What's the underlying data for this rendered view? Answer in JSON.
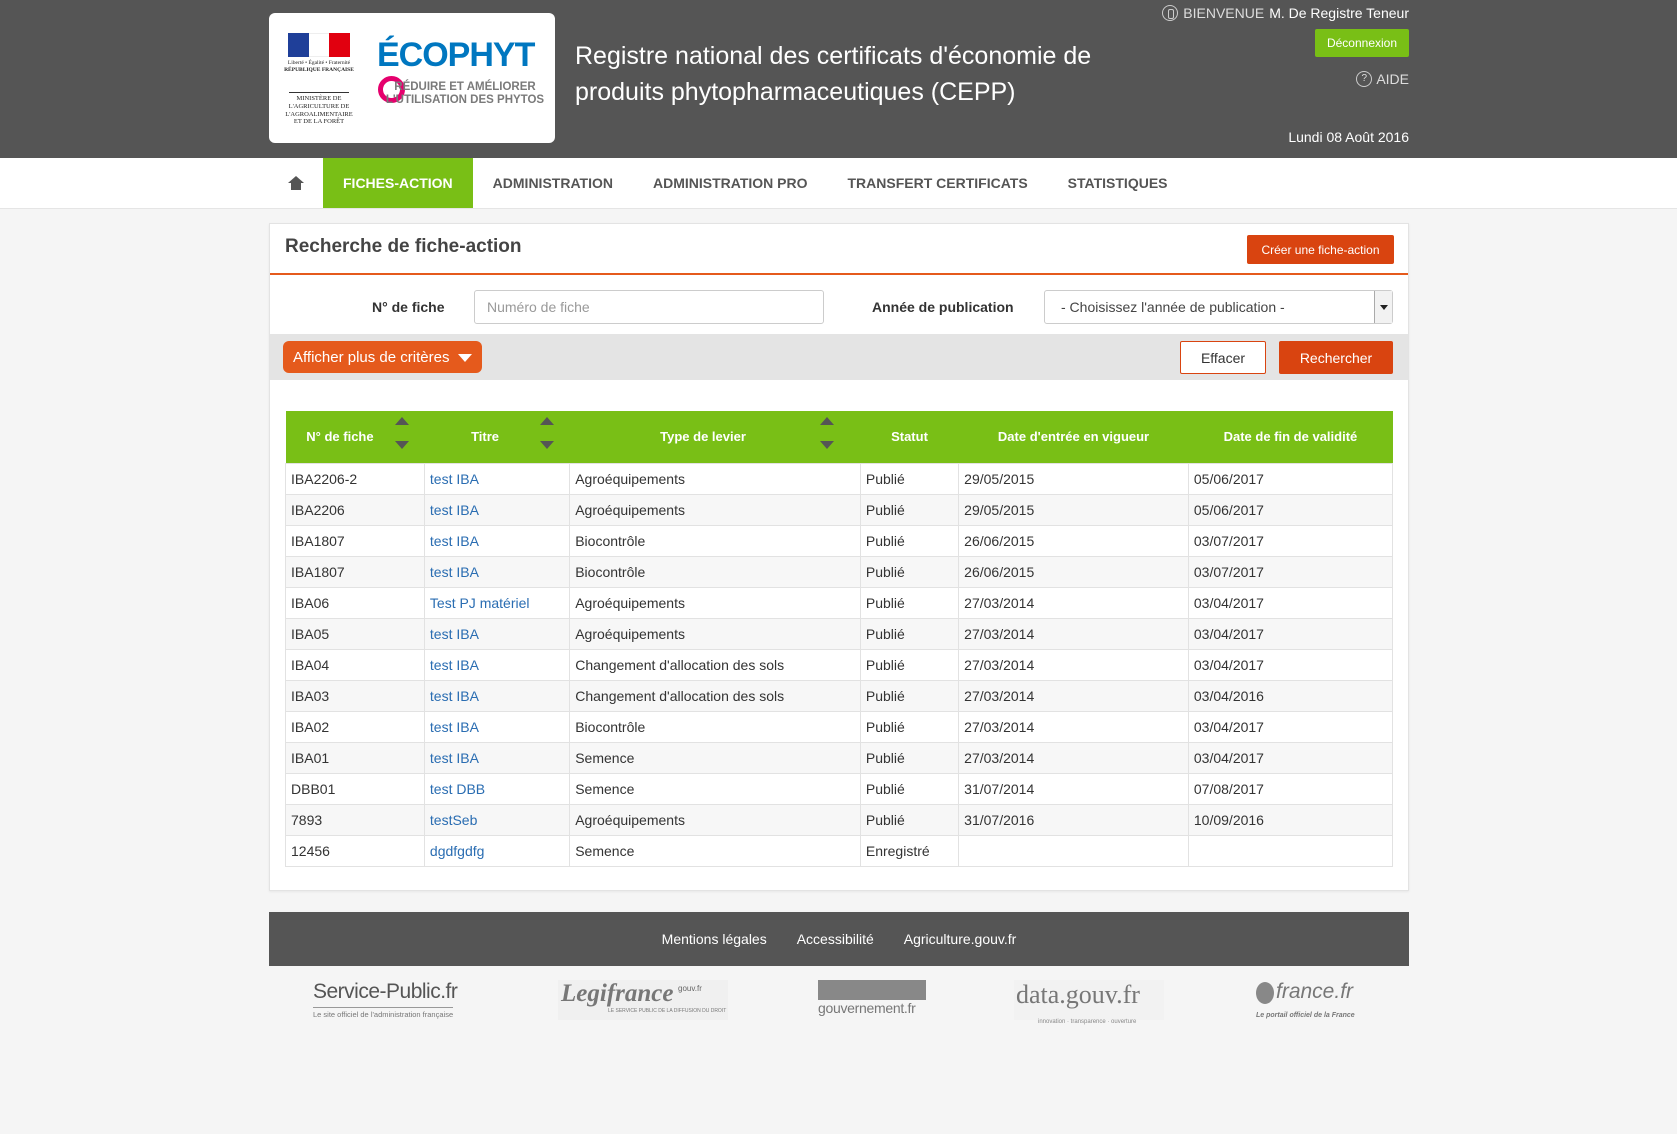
{
  "header": {
    "rf_line1": "Liberté • Égalité • Fraternité",
    "rf_line2": "RÉPUBLIQUE FRANÇAISE",
    "ministry": "MINISTÈRE DE L'AGRICULTURE DE L'AGROALIMENTAIRE ET DE LA FORÊT",
    "brand": "ÉCOPHYT",
    "brand_sub": "RÉDUIRE ET AMÉLIORER L'UTILISATION DES PHYTOS",
    "app_title": "Registre national des certificats d'économie de produits phytopharmaceutiques (CEPP)",
    "welcome_label": "BIENVENUE",
    "user_name": "M. De Registre Teneur",
    "logout_label": "Déconnexion",
    "help_label": "AIDE",
    "date": "Lundi 08 Août 2016",
    "colors": {
      "bar": "#555555",
      "accent": "#79bf16",
      "action": "#d94410"
    }
  },
  "nav": {
    "home_icon": "home-icon",
    "items": [
      {
        "label": "FICHES-ACTION",
        "active": true
      },
      {
        "label": "ADMINISTRATION",
        "active": false
      },
      {
        "label": "ADMINISTRATION PRO",
        "active": false
      },
      {
        "label": "TRANSFERT CERTIFICATS",
        "active": false
      },
      {
        "label": "STATISTIQUES",
        "active": false
      }
    ]
  },
  "search": {
    "title": "Recherche de fiche-action",
    "create_label": "Créer une fiche-action",
    "fiche_label": "N° de fiche",
    "fiche_placeholder": "Numéro de fiche",
    "fiche_value": "",
    "annee_label": "Année de publication",
    "annee_selected": "- Choisissez l'année de publication -",
    "more_label": "Afficher plus de critères",
    "clear_label": "Effacer",
    "search_label": "Rechercher"
  },
  "table": {
    "columns": [
      {
        "label": "N° de fiche",
        "sortable": true
      },
      {
        "label": "Titre",
        "sortable": true
      },
      {
        "label": "Type de levier",
        "sortable": true
      },
      {
        "label": "Statut",
        "sortable": false
      },
      {
        "label": "Date d'entrée en vigueur",
        "sortable": false
      },
      {
        "label": "Date de fin de validité",
        "sortable": false
      }
    ],
    "rows": [
      [
        "IBA2206-2",
        "test IBA",
        "Agroéquipements",
        "Publié",
        "29/05/2015",
        "05/06/2017"
      ],
      [
        "IBA2206",
        "test IBA",
        "Agroéquipements",
        "Publié",
        "29/05/2015",
        "05/06/2017"
      ],
      [
        "IBA1807",
        "test IBA",
        "Biocontrôle",
        "Publié",
        "26/06/2015",
        "03/07/2017"
      ],
      [
        "IBA1807",
        "test IBA",
        "Biocontrôle",
        "Publié",
        "26/06/2015",
        "03/07/2017"
      ],
      [
        "IBA06",
        "Test PJ matériel",
        "Agroéquipements",
        "Publié",
        "27/03/2014",
        "03/04/2017"
      ],
      [
        "IBA05",
        "test IBA",
        "Agroéquipements",
        "Publié",
        "27/03/2014",
        "03/04/2017"
      ],
      [
        "IBA04",
        "test IBA",
        "Changement d'allocation des sols",
        "Publié",
        "27/03/2014",
        "03/04/2017"
      ],
      [
        "IBA03",
        "test IBA",
        "Changement d'allocation des sols",
        "Publié",
        "27/03/2014",
        "03/04/2016"
      ],
      [
        "IBA02",
        "test IBA",
        "Biocontrôle",
        "Publié",
        "27/03/2014",
        "03/04/2017"
      ],
      [
        "IBA01",
        "test IBA",
        "Semence",
        "Publié",
        "27/03/2014",
        "03/04/2017"
      ],
      [
        "DBB01",
        "test DBB",
        "Semence",
        "Publié",
        "31/07/2014",
        "07/08/2017"
      ],
      [
        "7893",
        "testSeb",
        "Agroéquipements",
        "Publié",
        "31/07/2016",
        "10/09/2016"
      ],
      [
        "12456",
        "dgdfgdfg",
        "Semence",
        "Enregistré",
        "",
        ""
      ]
    ]
  },
  "footer": {
    "links": [
      "Mentions légales",
      "Accessibilité",
      "Agriculture.gouv.fr"
    ]
  },
  "partners": {
    "service_public": "Service-Public.fr",
    "service_public_sub": "Le site officiel de l'administration française",
    "legifrance": "Legifrance",
    "legifrance_gouv": "gouv.fr",
    "legifrance_sub": "LE SERVICE PUBLIC DE LA DIFFUSION DU DROIT",
    "gouvernement": "gouvernement.fr",
    "datagouv": "data.gouv.fr",
    "datagouv_sub": "innovation · transparence · ouverture",
    "francefr": "france.fr",
    "francefr_sub": "Le portail officiel de la France"
  }
}
